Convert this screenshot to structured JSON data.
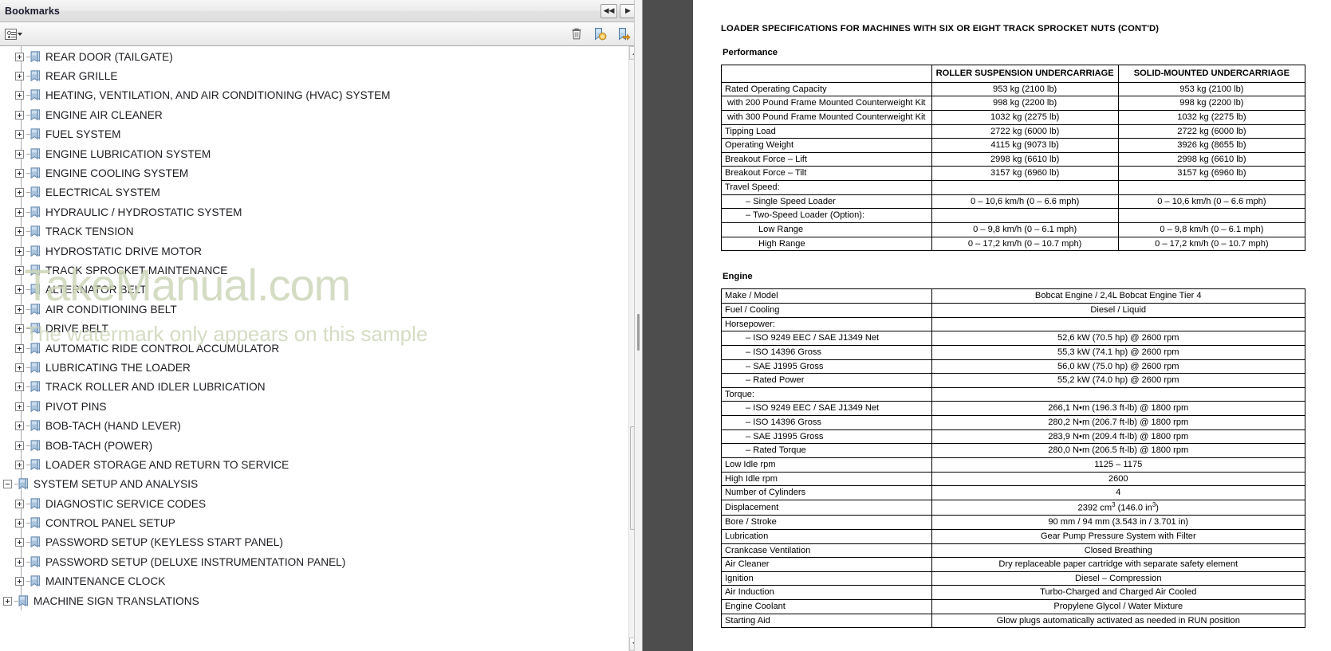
{
  "bookmarks_panel": {
    "title": "Bookmarks",
    "titlebar_buttons": [
      {
        "name": "collapse-all-button",
        "glyph": "◀◀"
      },
      {
        "name": "expand-panel-button",
        "glyph": "▶"
      }
    ],
    "toolbar": {
      "options_label": "Options",
      "delete_label": "Delete",
      "new_bookmark_label": "New Bookmark",
      "edit_bookmark_label": "Edit Bookmark"
    },
    "watermark": {
      "line1": "TakeManual.com",
      "line2": "The watermark only appears on this sample"
    },
    "items": [
      {
        "label": "REAR DOOR (TAILGATE)",
        "level": 2,
        "state": "collapsed"
      },
      {
        "label": "REAR GRILLE",
        "level": 2,
        "state": "collapsed"
      },
      {
        "label": "HEATING, VENTILATION, AND AIR CONDITIONING (HVAC) SYSTEM",
        "level": 2,
        "state": "collapsed"
      },
      {
        "label": "ENGINE AIR CLEANER",
        "level": 2,
        "state": "collapsed"
      },
      {
        "label": "FUEL SYSTEM",
        "level": 2,
        "state": "collapsed"
      },
      {
        "label": "ENGINE LUBRICATION SYSTEM",
        "level": 2,
        "state": "collapsed"
      },
      {
        "label": "ENGINE COOLING SYSTEM",
        "level": 2,
        "state": "collapsed"
      },
      {
        "label": "ELECTRICAL SYSTEM",
        "level": 2,
        "state": "collapsed"
      },
      {
        "label": "HYDRAULIC / HYDROSTATIC SYSTEM",
        "level": 2,
        "state": "collapsed"
      },
      {
        "label": "TRACK TENSION",
        "level": 2,
        "state": "collapsed"
      },
      {
        "label": "HYDROSTATIC DRIVE MOTOR",
        "level": 2,
        "state": "collapsed"
      },
      {
        "label": "TRACK SPROCKET MAINTENANCE",
        "level": 2,
        "state": "collapsed"
      },
      {
        "label": "ALTERNATOR BELT",
        "level": 2,
        "state": "collapsed"
      },
      {
        "label": "AIR CONDITIONING BELT",
        "level": 2,
        "state": "collapsed"
      },
      {
        "label": "DRIVE BELT",
        "level": 2,
        "state": "collapsed"
      },
      {
        "label": "AUTOMATIC RIDE CONTROL ACCUMULATOR",
        "level": 2,
        "state": "collapsed"
      },
      {
        "label": "LUBRICATING THE LOADER",
        "level": 2,
        "state": "collapsed"
      },
      {
        "label": "TRACK ROLLER AND IDLER LUBRICATION",
        "level": 2,
        "state": "collapsed"
      },
      {
        "label": "PIVOT PINS",
        "level": 2,
        "state": "collapsed"
      },
      {
        "label": "BOB-TACH (HAND LEVER)",
        "level": 2,
        "state": "collapsed"
      },
      {
        "label": "BOB-TACH (POWER)",
        "level": 2,
        "state": "collapsed"
      },
      {
        "label": "LOADER STORAGE AND RETURN TO SERVICE",
        "level": 2,
        "state": "collapsed"
      },
      {
        "label": "SYSTEM SETUP AND ANALYSIS",
        "level": 1,
        "state": "expanded"
      },
      {
        "label": "DIAGNOSTIC SERVICE CODES",
        "level": 2,
        "state": "collapsed"
      },
      {
        "label": "CONTROL PANEL SETUP",
        "level": 2,
        "state": "collapsed"
      },
      {
        "label": "PASSWORD SETUP (KEYLESS START PANEL)",
        "level": 2,
        "state": "collapsed"
      },
      {
        "label": "PASSWORD SETUP (DELUXE INSTRUMENTATION PANEL)",
        "level": 2,
        "state": "collapsed"
      },
      {
        "label": "MAINTENANCE CLOCK",
        "level": 2,
        "state": "collapsed"
      },
      {
        "label": "MACHINE SIGN TRANSLATIONS",
        "level": 1,
        "state": "collapsed"
      }
    ]
  },
  "document": {
    "title": "LOADER SPECIFICATIONS FOR MACHINES WITH SIX OR EIGHT TRACK SPROCKET NUTS (CONT'D)",
    "performance": {
      "heading": "Performance",
      "columns": [
        "",
        "ROLLER SUSPENSION UNDERCARRIAGE",
        "SOLID-MOUNTED UNDERCARRIAGE"
      ],
      "rows": [
        {
          "label": "Rated Operating Capacity",
          "align": "left",
          "c1": "953 kg (2100 lb)",
          "c2": "953 kg (2100 lb)"
        },
        {
          "label": "with 200 Pound Frame Mounted Counterweight Kit",
          "align": "center",
          "c1": "998 kg (2200 lb)",
          "c2": "998 kg (2200 lb)"
        },
        {
          "label": "with 300 Pound Frame Mounted Counterweight Kit",
          "align": "center",
          "c1": "1032 kg (2275 lb)",
          "c2": "1032 kg (2275 lb)"
        },
        {
          "label": "Tipping Load",
          "align": "left",
          "c1": "2722 kg (6000 lb)",
          "c2": "2722 kg (6000 lb)"
        },
        {
          "label": "Operating Weight",
          "align": "left",
          "c1": "4115 kg (9073 lb)",
          "c2": "3926 kg (8655 lb)"
        },
        {
          "label": "Breakout Force – Lift",
          "align": "left",
          "c1": "2998 kg (6610 lb)",
          "c2": "2998 kg (6610 lb)"
        },
        {
          "label": "Breakout Force – Tilt",
          "align": "left",
          "c1": "3157 kg (6960 lb)",
          "c2": "3157 kg (6960 lb)"
        },
        {
          "label": "Travel Speed:",
          "align": "left",
          "c1": "",
          "c2": ""
        },
        {
          "label": "– Single Speed Loader",
          "align": "indent",
          "c1": "0 – 10,6 km/h (0 – 6.6 mph)",
          "c2": "0 – 10,6 km/h (0 – 6.6 mph)"
        },
        {
          "label": "– Two-Speed Loader (Option):",
          "align": "indent",
          "c1": "",
          "c2": ""
        },
        {
          "label": "Low Range",
          "align": "indent2",
          "c1": "0 – 9,8 km/h (0 – 6.1 mph)",
          "c2": "0 – 9,8 km/h (0 – 6.1 mph)"
        },
        {
          "label": "High Range",
          "align": "indent2",
          "c1": "0 – 17,2 km/h (0 – 10.7 mph)",
          "c2": "0 – 17,2 km/h (0 – 10.7 mph)"
        }
      ]
    },
    "engine": {
      "heading": "Engine",
      "rows": [
        {
          "label": "Make / Model",
          "align": "left",
          "value": "Bobcat Engine / 2,4L Bobcat Engine Tier 4"
        },
        {
          "label": "Fuel / Cooling",
          "align": "left",
          "value": "Diesel / Liquid"
        },
        {
          "label": "Horsepower:",
          "align": "left",
          "value": ""
        },
        {
          "label": "– ISO 9249 EEC / SAE J1349 Net",
          "align": "indent",
          "value": "52,6 kW (70.5 hp) @ 2600 rpm"
        },
        {
          "label": "– ISO 14396 Gross",
          "align": "indent",
          "value": "55,3 kW (74.1 hp) @ 2600 rpm"
        },
        {
          "label": "– SAE J1995 Gross",
          "align": "indent",
          "value": "56,0 kW (75.0 hp) @ 2600 rpm"
        },
        {
          "label": "– Rated Power",
          "align": "indent",
          "value": "55,2 kW (74.0 hp) @ 2600 rpm"
        },
        {
          "label": "Torque:",
          "align": "left",
          "value": ""
        },
        {
          "label": "– ISO 9249 EEC / SAE J1349 Net",
          "align": "indent",
          "value": "266,1 N•m (196.3 ft-lb) @ 1800 rpm"
        },
        {
          "label": "– ISO 14396 Gross",
          "align": "indent",
          "value": "280,2 N•m (206.7 ft-lb) @ 1800 rpm"
        },
        {
          "label": "– SAE J1995 Gross",
          "align": "indent",
          "value": "283,9 N•m (209.4 ft-lb) @ 1800 rpm"
        },
        {
          "label": "– Rated Torque",
          "align": "indent",
          "value": "280,0 N•m (206.5 ft-lb) @ 1800 rpm"
        },
        {
          "label": "Low Idle rpm",
          "align": "left",
          "value": "1125 – 1175"
        },
        {
          "label": "High Idle rpm",
          "align": "left",
          "value": "2600"
        },
        {
          "label": "Number of Cylinders",
          "align": "left",
          "value": "4"
        },
        {
          "label": "Displacement",
          "align": "left",
          "value": "2392 cm³ (146.0 in³)",
          "html": "2392 cm<sup>3</sup> (146.0 in<sup>3</sup>)"
        },
        {
          "label": "Bore / Stroke",
          "align": "left",
          "value": "90 mm / 94 mm (3.543 in / 3.701 in)"
        },
        {
          "label": "Lubrication",
          "align": "left",
          "value": "Gear Pump Pressure System with Filter"
        },
        {
          "label": "Crankcase Ventilation",
          "align": "left",
          "value": "Closed Breathing"
        },
        {
          "label": "Air Cleaner",
          "align": "left",
          "value": "Dry replaceable paper cartridge with separate safety element"
        },
        {
          "label": "Ignition",
          "align": "left",
          "value": "Diesel – Compression"
        },
        {
          "label": "Air Induction",
          "align": "left",
          "value": "Turbo-Charged and Charged Air Cooled"
        },
        {
          "label": "Engine Coolant",
          "align": "left",
          "value": "Propylene Glycol / Water Mixture"
        },
        {
          "label": "Starting Aid",
          "align": "left",
          "value": "Glow plugs automatically activated as needed in RUN position"
        }
      ]
    }
  },
  "colors": {
    "bookmark_icon": "#9bb7d4",
    "watermark": "#cdd6b9",
    "pdf_backdrop": "#4d4d4d",
    "panel_chrome": "#ececed"
  }
}
